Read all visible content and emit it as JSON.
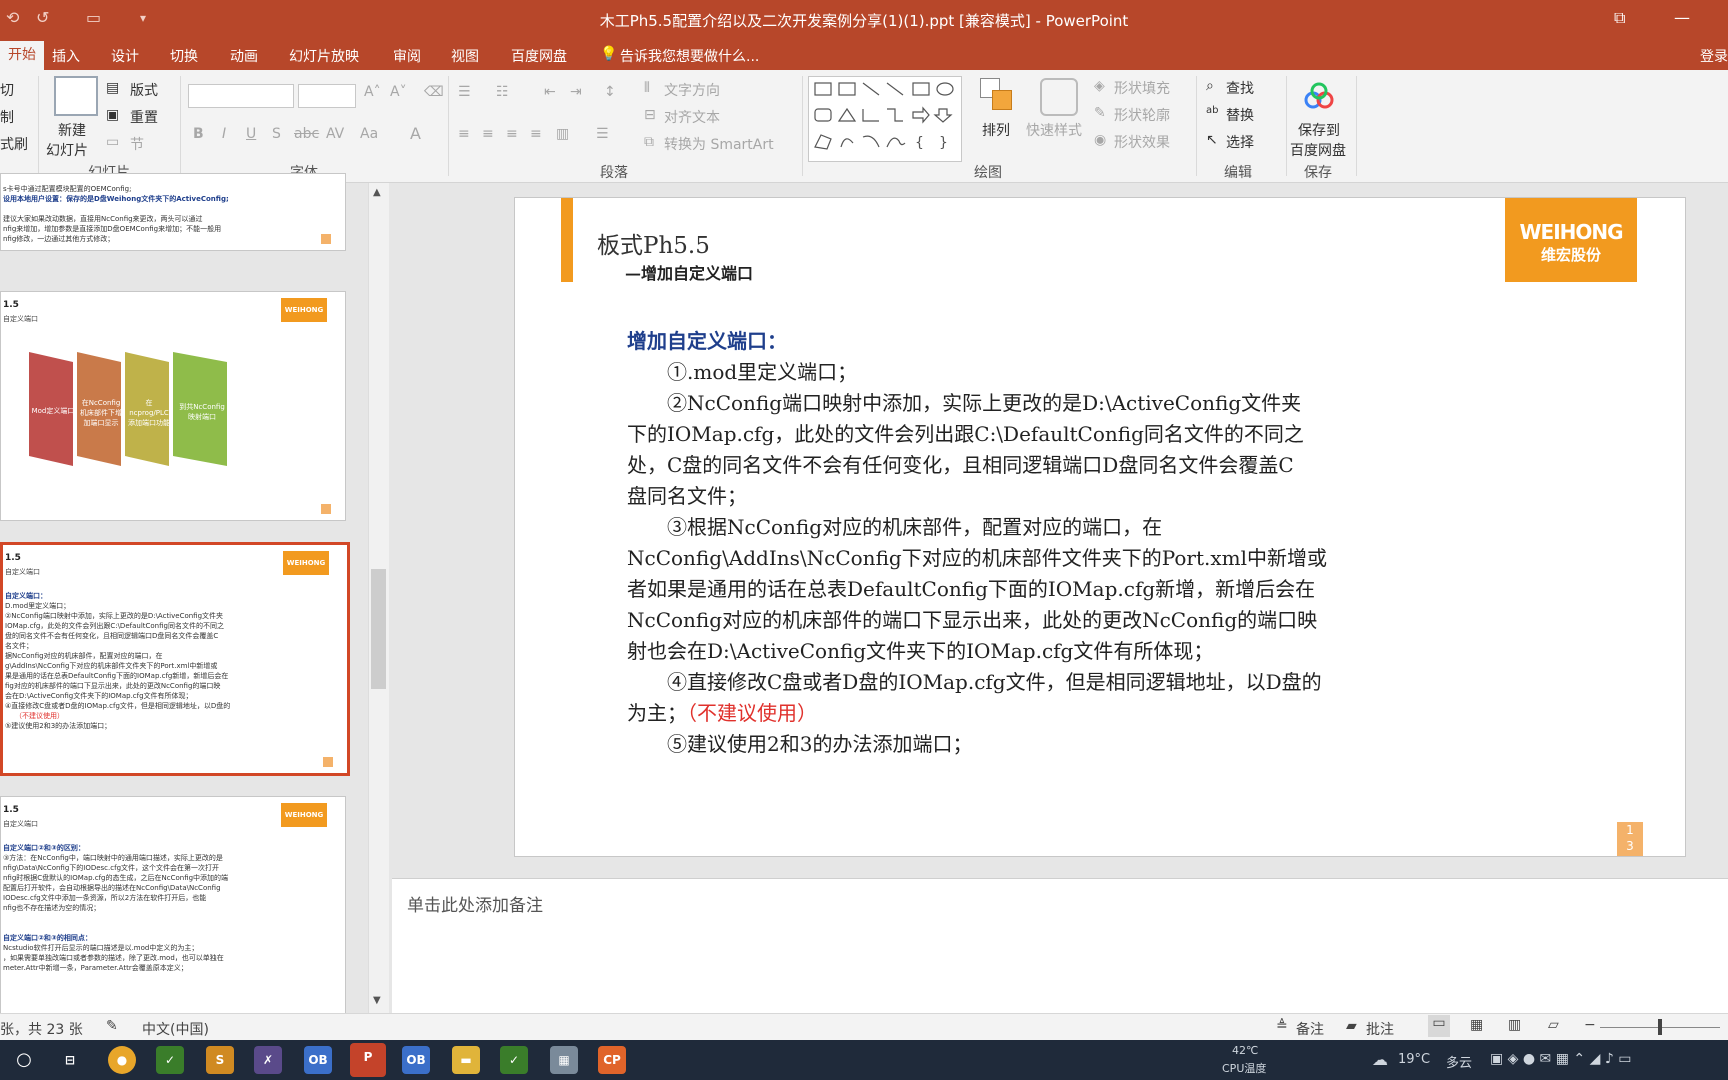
{
  "window": {
    "title": "木工Ph5.5配置介绍以及二次开发案例分享(1)(1).ppt [兼容模式] - PowerPoint"
  },
  "tabs": [
    {
      "label": "开始",
      "active": true
    },
    {
      "label": "插入"
    },
    {
      "label": "设计"
    },
    {
      "label": "切换"
    },
    {
      "label": "动画"
    },
    {
      "label": "幻灯片放映"
    },
    {
      "label": "审阅"
    },
    {
      "label": "视图"
    },
    {
      "label": "百度网盘"
    }
  ],
  "tell_me": "告诉我您想要做什么...",
  "login": "登录",
  "ribbon": {
    "clipboard": {
      "cut": "切",
      "copy": "制",
      "format_painter": "式刷"
    },
    "slides": {
      "new_slide_1": "新建",
      "new_slide_2": "幻灯片",
      "layout": "版式",
      "reset": "重置",
      "section": "节",
      "group": "幻灯片"
    },
    "font": {
      "group": "字体"
    },
    "paragraph": {
      "text_direction": "文字方向",
      "align_text": "对齐文本",
      "smartart": "转换为 SmartArt",
      "group": "段落"
    },
    "drawing": {
      "arrange": "排列",
      "quick_styles": "快速样式",
      "shape_fill": "形状填充",
      "shape_outline": "形状轮廓",
      "shape_effects": "形状效果",
      "group": "绘图"
    },
    "editing": {
      "find": "查找",
      "replace": "替换",
      "select": "选择",
      "group": "编辑"
    },
    "save": {
      "save_to_1": "保存到",
      "save_to_2": "百度网盘",
      "group": "保存"
    }
  },
  "thumbs": [
    {
      "lines": [
        "s卡号中通过配置模块配置的OEMConfig;",
        "设用本地用户设置：保存的是D盘Weihong文件夹下的ActiveConfig;",
        "",
        "建议大家如果改动数据，直接用NcConfig来更改，两头可以通过",
        "nfig来增加，增加参数是直接添加D盘OEMConfig来增加；不能一般用",
        "nfig修改，一边通过其他方式修改；"
      ]
    },
    {
      "title": "1.5",
      "subtitle": "自定义端口",
      "logo": "WEIHONG",
      "steps": [
        "Mod定义端口",
        "在NcConfig机床部件下增加端口显示",
        "在ncprog/PLC添加端口功能",
        "到共NcConfig映射端口"
      ]
    },
    {
      "title": "1.5",
      "subtitle": "自定义端口",
      "logo": "WEIHONG",
      "lines": [
        "自定义端口：",
        "D.mod里定义端口；",
        "②NcConfig端口映射中添加，实际上更改的是D:\\ActiveConfig文件夹",
        "IOMap.cfg，此处的文件会列出跟C:\\DefaultConfig同名文件的不同之",
        "盘的同名文件不会有任何变化，且相同逻辑端口D盘同名文件会覆盖C",
        "名文件；",
        "据NcConfig对应的机床部件，配置对应的端口，在",
        "g\\AddIns\\NcConfig下对应的机床部件文件夹下的Port.xml中新增或",
        "果是通用的话在总表DefaultConfig下面的IOMap.cfg新增，新增后会在",
        "fig对应的机床部件的端口下显示出来，此处的更改NcConfig的端口映",
        "会在D:\\ActiveConfig文件夹下的IOMap.cfg文件有所体现；",
        "④直接修改C盘或者D盘的IOMap.cfg文件，但是相同逻辑地址，以D盘的",
        "（不建议使用）",
        "⑤建议使用2和3的办法添加端口；"
      ]
    },
    {
      "title": "1.5",
      "subtitle": "自定义端口",
      "logo": "WEIHONG",
      "lines": [
        "自定义端口②和③的区别：",
        "③方法：在NcConfig中，端口映射中的通用端口描述，实际上更改的是",
        "nfig\\Data\\NcConfig下的IODesc.cfg文件，这个文件会在第一次打开",
        "nfig时根据C盘默认的IOMap.cfg的态生成，之后在NcConfig中添加的端",
        "配置后打开软件，会自动根据导出的描述在NcConfig\\Data\\NcConfig",
        "IODesc.cfg文件中添加一条资源，所以2方法在软件打开后，也能",
        "nfig也不存在描述为空的情况；",
        "",
        "",
        "自定义端口②和③的相同点：",
        "Ncstudio软件打开后显示的端口描述是以.mod中定义的为主；",
        "，如果需要单独改端口或者参数的描述，除了更改.mod，也可以单独在",
        "meter.Attr中新增一条，Parameter.Attr会覆盖原本定义；"
      ]
    }
  ],
  "slide": {
    "title": "板式Ph5.5",
    "subtitle": "—增加自定义端口",
    "logo_en": "WEIHONG",
    "logo_cn": "维宏股份",
    "heading": "增加自定义端口：",
    "body_lines": [
      "　　①.mod里定义端口；",
      "　　②NcConfig端口映射中添加，实际上更改的是D:\\ActiveConfig文件夹",
      "下的IOMap.cfg，此处的文件会列出跟C:\\DefaultConfig同名文件的不同之",
      "处，C盘的同名文件不会有任何变化，且相同逻辑端口D盘同名文件会覆盖C",
      "盘同名文件；",
      "　　③根据NcConfig对应的机床部件，配置对应的端口，在",
      "NcConfig\\AddIns\\NcConfig下对应的机床部件文件夹下的Port.xml中新增或",
      "者如果是通用的话在总表DefaultConfig下面的IOMap.cfg新增，新增后会在",
      "NcConfig对应的机床部件的端口下显示出来，此处的更改NcConfig的端口映",
      "射也会在D:\\ActiveConfig文件夹下的IOMap.cfg文件有所体现；",
      "　　④直接修改C盘或者D盘的IOMap.cfg文件，但是相同逻辑地址，以D盘的"
    ],
    "line12_prefix": "为主；",
    "line12_red": "（不建议使用）",
    "last_line": "　　⑤建议使用2和3的办法添加端口；",
    "page_num_1": "1",
    "page_num_2": "3"
  },
  "notes_placeholder": "单击此处添加备注",
  "status": {
    "slide_count": "张，共 23 张",
    "language": "中文(中国)",
    "notes": "备注",
    "comments": "批注"
  },
  "taskbar": {
    "temp": "42℃",
    "cpu_label": "CPU温度",
    "weather_temp": "19°C",
    "weather": "多云"
  },
  "colors": {
    "ppt_red": "#b7472a",
    "accent_orange": "#f29a1f",
    "slide_heading": "#1f3f8c",
    "red_text": "#e0312c"
  }
}
